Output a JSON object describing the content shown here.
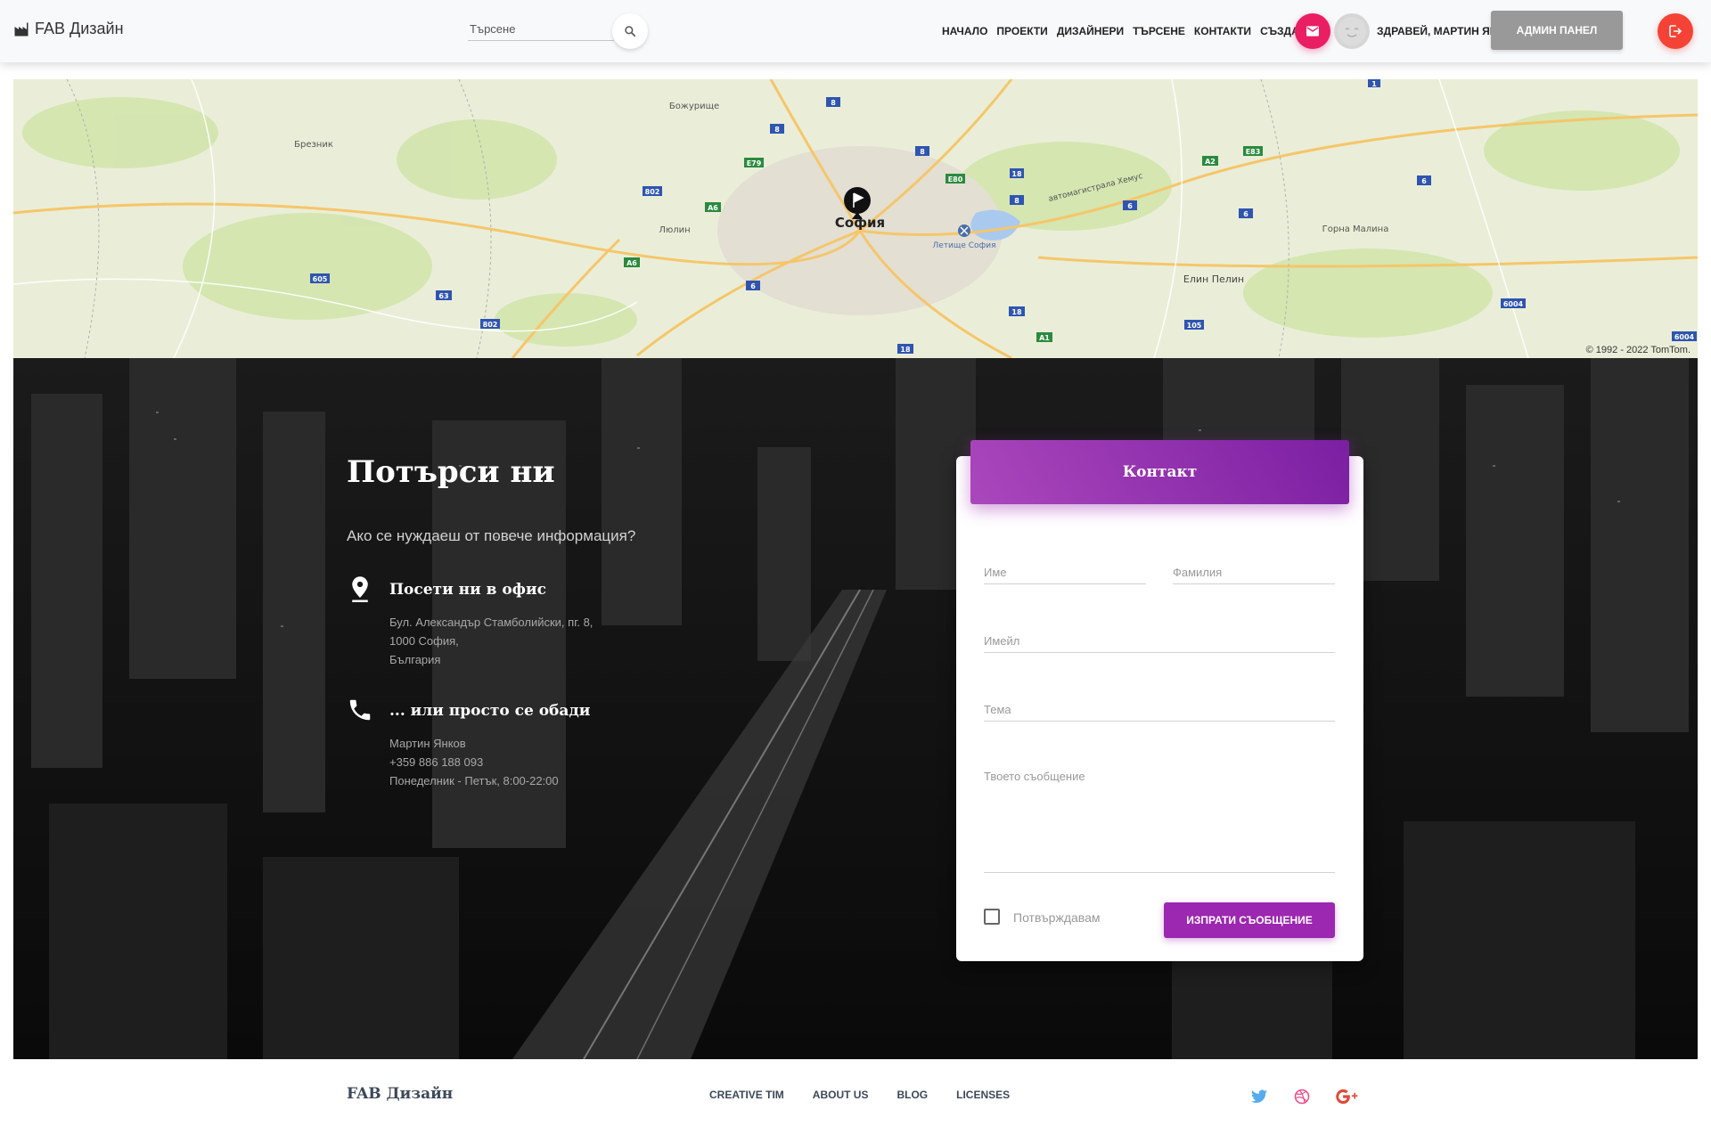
{
  "navbar": {
    "brand": "FAB Дизайн",
    "search_placeholder": "Търсене",
    "links": [
      "НАЧАЛО",
      "ПРОЕКТИ",
      "ДИЗАЙНЕРИ",
      "ТЪРСЕНЕ",
      "КОНТАКТИ",
      "СЪЗДАЙ"
    ],
    "greeting": "ЗДРАВЕЙ, МАРТИН ЯНКОВ!",
    "admin_label": "АДМИН ПАНЕЛ",
    "icons": {
      "mail": "mail-icon",
      "avatar": "user-avatar",
      "logout": "logout-icon",
      "search": "search-icon"
    },
    "colors": {
      "mail": "#e91e63",
      "logout": "#f44336",
      "admin": "#999999"
    }
  },
  "map": {
    "places": [
      "Божурище",
      "Брезник",
      "Люлин",
      "София",
      "Летище София",
      "Елин Пелин",
      "Горна Малина",
      "автомагистрала Хемус"
    ],
    "road_labels": [
      "8",
      "8",
      "8",
      "E79",
      "802",
      "A6",
      "A6",
      "6",
      "E80",
      "18",
      "8",
      "A2",
      "E83",
      "6",
      "6",
      "6",
      "605",
      "63",
      "802",
      "18",
      "A1",
      "18",
      "105",
      "6004",
      "6004",
      "1"
    ],
    "copyright": "© 1992 - 2022 TomTom."
  },
  "hero": {
    "title": "Потърси ни",
    "subtitle": "Ако се нуждаеш от повече информация?",
    "office": {
      "title": "Посети ни в офис",
      "lines": [
        "Бул. Александър Стамболийски, пг. 8,",
        "1000 София,",
        "България"
      ]
    },
    "phone": {
      "title": "... или просто се обади",
      "lines": [
        "Мартин Янков",
        "+359 886 188 093",
        "Понеделник - Петък, 8:00-22:00"
      ]
    }
  },
  "contact_form": {
    "header": "Контакт",
    "first_name_placeholder": "Име",
    "last_name_placeholder": "Фамилия",
    "email_placeholder": "Имейл",
    "subject_placeholder": "Тема",
    "message_placeholder": "Твоето съобщение",
    "confirm_label": "Потвърждавам",
    "send_label": "ИЗПРАТИ СЪОБЩЕНИЕ",
    "accent": "#9c27b0"
  },
  "footer": {
    "brand": "FAB Дизайн",
    "links": [
      "CREATIVE TIM",
      "ABOUT US",
      "BLOG",
      "LICENSES"
    ],
    "social": [
      {
        "name": "twitter-icon",
        "color": "#55acee"
      },
      {
        "name": "dribbble-icon",
        "color": "#ea4c89"
      },
      {
        "name": "google-plus-icon",
        "color": "#dd4b39"
      }
    ]
  }
}
